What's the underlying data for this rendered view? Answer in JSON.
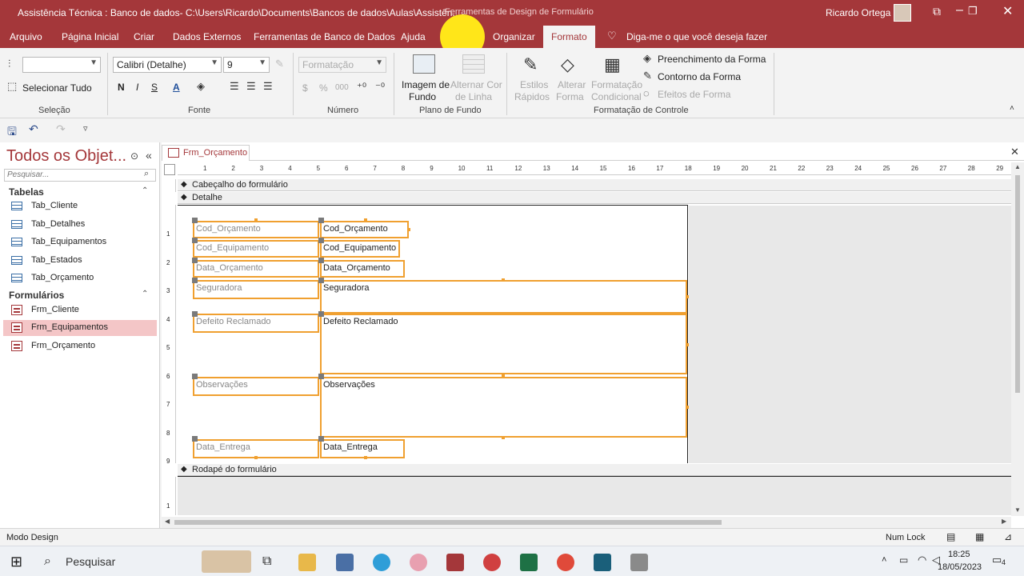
{
  "titlebar": {
    "title": "Assistência Técnica : Banco de dados- C:\\Users\\Ricardo\\Documents\\Bancos de dados\\Aulas\\Assistên...",
    "context_tab": "Ferramentas de Design de Formulário",
    "user": "Ricardo Ortega"
  },
  "tabs": [
    "Arquivo",
    "Página Inicial",
    "Criar",
    "Dados Externos",
    "Ferramentas de Banco de Dados",
    "Ajuda",
    "Organizar",
    "Formato"
  ],
  "tell_me": "Diga-me o que você deseja fazer",
  "ribbon": {
    "selecao": {
      "label": "Seleção",
      "select_all": "Selecionar Tudo"
    },
    "fonte": {
      "label": "Fonte",
      "font": "Calibri (Detalhe)",
      "size": "9",
      "bold": "N",
      "italic": "I",
      "underline": "S",
      "font_color": "A"
    },
    "numero": {
      "label": "Número",
      "format": "Formatação",
      "currency": "$",
      "percent": "%",
      "thousands": "000"
    },
    "plano_fundo": {
      "label": "Plano de Fundo",
      "image_1": "Imagem de",
      "image_2": "Fundo",
      "alt_1": "Alternar Cor",
      "alt_2": "de Linha"
    },
    "formatacao": {
      "label": "Formatação de Controle",
      "quick_1": "Estilos",
      "quick_2": "Rápidos",
      "change_1": "Alterar",
      "change_2": "Forma",
      "cond_1": "Formatação",
      "cond_2": "Condicional",
      "fill": "Preenchimento da Forma",
      "outline": "Contorno da Forma",
      "effects": "Efeitos de Forma"
    }
  },
  "navpane": {
    "title": "Todos os Objet...",
    "search_placeholder": "Pesquisar...",
    "sections": [
      {
        "name": "Tabelas",
        "items": [
          "Tab_Cliente",
          "Tab_Detalhes",
          "Tab_Equipamentos",
          "Tab_Estados",
          "Tab_Orçamento"
        ]
      },
      {
        "name": "Formulários",
        "items": [
          "Frm_Cliente",
          "Frm_Equipamentos",
          "Frm_Orçamento"
        ]
      }
    ],
    "selected": "Frm_Equipamentos"
  },
  "document": {
    "tab": "Frm_Orçamento",
    "ruler_numbers": [
      "1",
      "2",
      "3",
      "4",
      "5",
      "6",
      "7",
      "8",
      "9",
      "10",
      "11",
      "12",
      "13",
      "14",
      "15",
      "16",
      "17",
      "18",
      "19",
      "20",
      "21",
      "22",
      "23",
      "24",
      "25",
      "26",
      "27",
      "28",
      "29"
    ],
    "vruler_detail": [
      "1",
      "2",
      "3",
      "4",
      "5",
      "6",
      "7",
      "8",
      "9"
    ],
    "vruler_footer": [
      "1"
    ],
    "sections": {
      "header": "Cabeçalho do formulário",
      "detail": "Detalhe",
      "footer": "Rodapé do formulário"
    },
    "fields": [
      {
        "label": "Cod_Orçamento",
        "control": "Cod_Orçamento"
      },
      {
        "label": "Cod_Equipamento",
        "control": "Cod_Equipamento"
      },
      {
        "label": "Data_Orçamento",
        "control": "Data_Orçamento"
      },
      {
        "label": "Seguradora",
        "control": "Seguradora"
      },
      {
        "label": "Defeito Reclamado",
        "control": "Defeito Reclamado"
      },
      {
        "label": "Observações",
        "control": "Observações"
      },
      {
        "label": "Data_Entrega",
        "control": "Data_Entrega"
      }
    ]
  },
  "statusbar": {
    "mode": "Modo Design",
    "numlock": "Num Lock"
  },
  "taskbar": {
    "search": "Pesquisar",
    "time": "18:25",
    "date": "18/05/2023",
    "notifications": "4"
  },
  "colors": {
    "access_red": "#a4373a",
    "control_border": "#f0a030",
    "selected_item": "#f4c6c7"
  }
}
